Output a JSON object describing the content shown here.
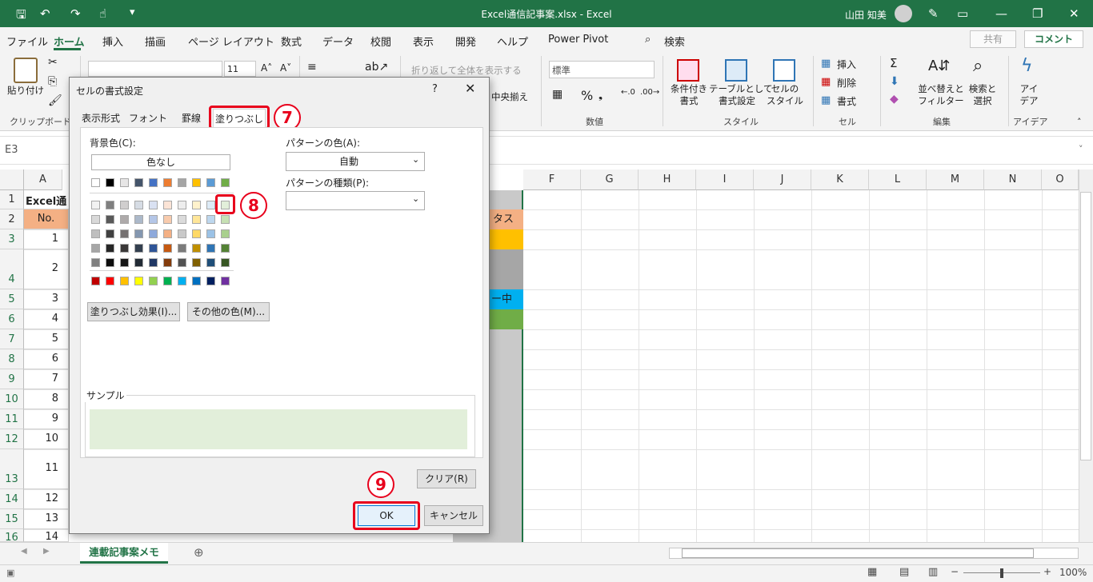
{
  "window": {
    "title": "Excel通信記事案.xlsx  -  Excel",
    "user": "山田 知美"
  },
  "menu": {
    "items": [
      "ファイル",
      "ホーム",
      "挿入",
      "描画",
      "ページ レイアウト",
      "数式",
      "データ",
      "校閲",
      "表示",
      "開発",
      "ヘルプ",
      "Power Pivot"
    ],
    "search": "検索",
    "share": "共有",
    "comment": "コメント"
  },
  "ribbon": {
    "paste": "貼り付け",
    "clipboard_group": "クリップボード",
    "font_size": "11",
    "wrap_text": "折り返して全体を表示する",
    "merge_center": "中央揃え",
    "number_format": "標準",
    "number_group": "数値",
    "conditional_format": "条件付き\n書式",
    "format_as_table": "テーブルとして\n書式設定",
    "cell_styles": "セルの\nスタイル",
    "styles_group": "スタイル",
    "insert": "挿入",
    "delete": "削除",
    "format": "書式",
    "cells_group": "セル",
    "sort_filter": "並べ替えと\nフィルター",
    "find_select": "検索と\n選択",
    "editing_group": "編集",
    "ideas": "アイ\nデア",
    "ideas_group": "アイデア"
  },
  "namebox": "E3",
  "grid": {
    "columns": [
      "A",
      "F",
      "G",
      "H",
      "I",
      "J",
      "K",
      "L",
      "M",
      "N",
      "O"
    ],
    "rows": [
      "1",
      "2",
      "3",
      "4",
      "5",
      "6",
      "7",
      "8",
      "9",
      "10",
      "11",
      "12",
      "13",
      "14",
      "15",
      "16"
    ],
    "a1": "Excel通",
    "a2": "No.",
    "numbers": [
      "1",
      "2",
      "3",
      "4",
      "5",
      "6",
      "7",
      "8",
      "9",
      "10",
      "11",
      "12",
      "13",
      "14"
    ],
    "e2": "タス",
    "e5": "ー中"
  },
  "dialog": {
    "title": "セルの書式設定",
    "help": "?",
    "tabs": [
      "表示形式",
      "フォント",
      "罫線",
      "塗りつぶし"
    ],
    "bg_color_label": "背景色(C):",
    "no_color": "色なし",
    "fill_effects": "塗りつぶし効果(I)...",
    "more_colors": "その他の色(M)...",
    "pattern_color_label": "パターンの色(A):",
    "pattern_color_value": "自動",
    "pattern_style_label": "パターンの種類(P):",
    "sample_label": "サンプル",
    "clear": "クリア(R)",
    "ok": "OK",
    "cancel": "キャンセル",
    "sample_color": "#e2efda",
    "theme_row": [
      "#ffffff",
      "#000000",
      "#e7e6e6",
      "#44546a",
      "#4472c4",
      "#ed7d31",
      "#a5a5a5",
      "#ffc000",
      "#5b9bd5",
      "#70ad47"
    ],
    "shades": [
      [
        "#f2f2f2",
        "#7f7f7f",
        "#d0cece",
        "#d6dce4",
        "#d9e1f2",
        "#fce4d6",
        "#ededed",
        "#fff2cc",
        "#ddebf7",
        "#e2efda"
      ],
      [
        "#d9d9d9",
        "#595959",
        "#aeaaaa",
        "#acb9ca",
        "#b4c6e7",
        "#f8cbad",
        "#dbdbdb",
        "#ffe699",
        "#bdd7ee",
        "#c6e0b4"
      ],
      [
        "#bfbfbf",
        "#404040",
        "#757171",
        "#8497b0",
        "#8ea9db",
        "#f4b084",
        "#c9c9c9",
        "#ffd966",
        "#9bc2e6",
        "#a9d08e"
      ],
      [
        "#a6a6a6",
        "#262626",
        "#3a3838",
        "#333f4f",
        "#2f5597",
        "#c65911",
        "#7b7b7b",
        "#bf8f00",
        "#2f75b5",
        "#548235"
      ],
      [
        "#808080",
        "#0d0d0d",
        "#161616",
        "#222b35",
        "#203764",
        "#833c0c",
        "#525252",
        "#806000",
        "#1f4e78",
        "#375623"
      ]
    ],
    "standard": [
      "#c00000",
      "#ff0000",
      "#ffc000",
      "#ffff00",
      "#92d050",
      "#00b050",
      "#00b0f0",
      "#0070c0",
      "#002060",
      "#7030a0"
    ]
  },
  "annotations": [
    "7",
    "8",
    "9"
  ],
  "sheet_tab": "連載記事案メモ",
  "zoom": "100%"
}
